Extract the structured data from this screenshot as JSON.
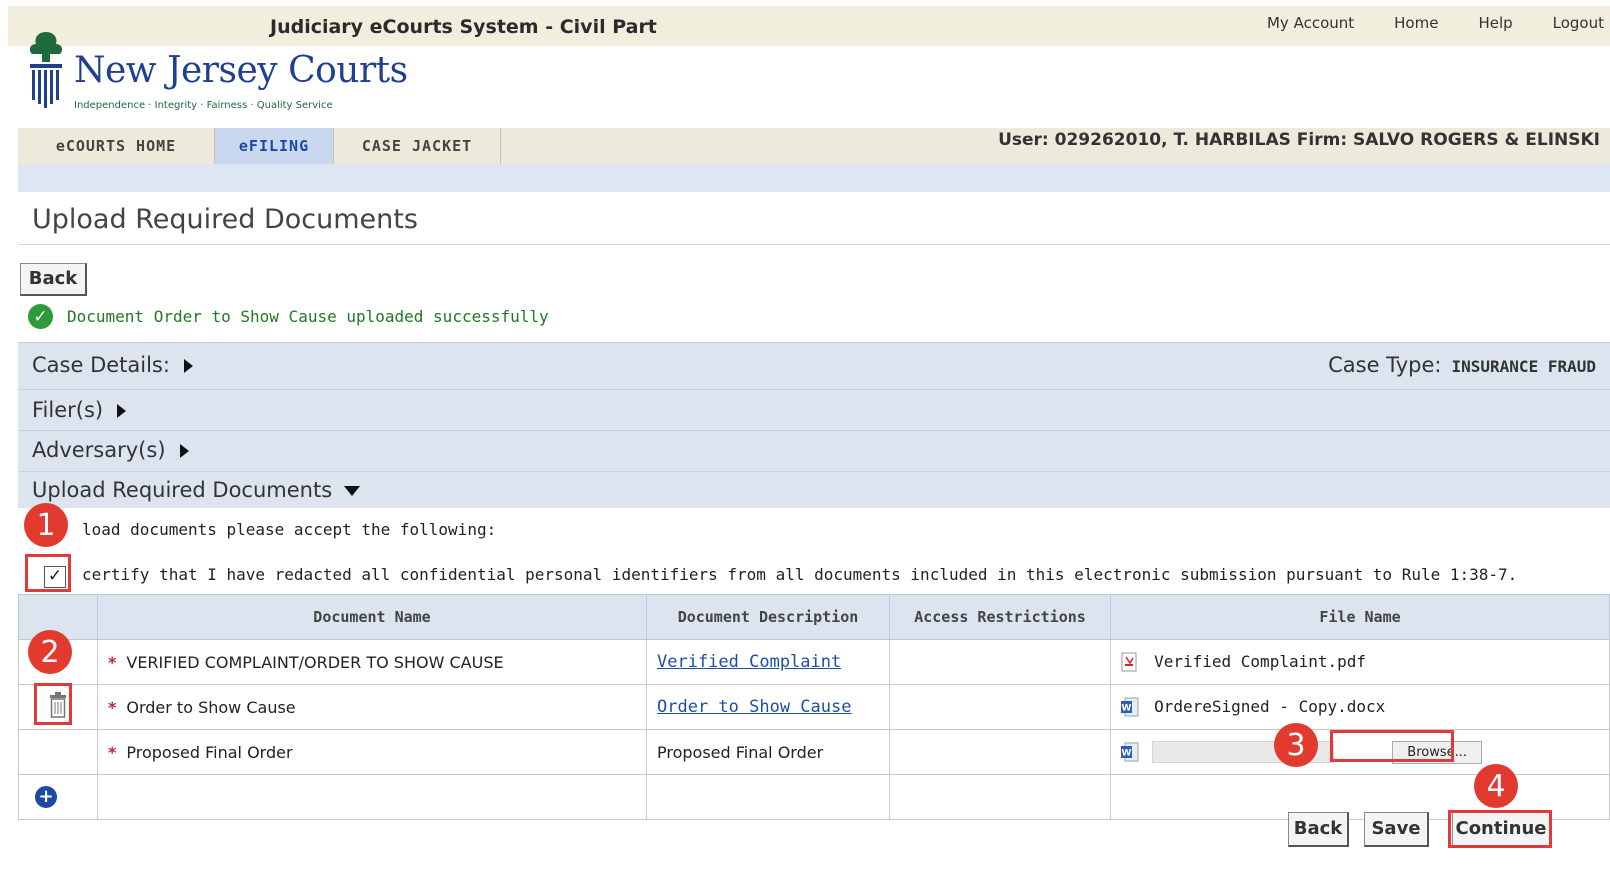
{
  "header": {
    "system_title": "Judiciary eCourts System - Civil Part",
    "links": [
      "My Account",
      "Home",
      "Help",
      "Logout"
    ],
    "logo_title": "New Jersey Courts",
    "logo_tagline": "Independence · Integrity · Fairness · Quality Service",
    "tabs": [
      "eCOURTS HOME",
      "eFILING",
      "CASE JACKET"
    ],
    "active_tab": "eFILING",
    "user_line": "User: 029262010, T. HARBILAS  Firm: SALVO ROGERS & ELINSKI"
  },
  "page": {
    "title": "Upload Required Documents",
    "back_label": "Back",
    "success_message": "Document Order to Show Cause uploaded successfully"
  },
  "sections": {
    "case_details": "Case Details:",
    "case_type_label": "Case Type:",
    "case_type_value": "INSURANCE FRAUD",
    "filers": "Filer(s)",
    "adversaries": "Adversary(s)",
    "upload": "Upload Required Documents"
  },
  "upload": {
    "instruction": "load documents please accept the following:",
    "certify_text": "certify that I have redacted all confidential personal identifiers from all documents included in this electronic submission pursuant to Rule 1:38-7.",
    "certify_checked": true,
    "columns": [
      "Document Name",
      "Document Description",
      "Access Restrictions",
      "File Name"
    ],
    "rows": [
      {
        "name": "VERIFIED COMPLAINT/ORDER TO SHOW CAUSE",
        "description": "Verified Complaint",
        "file": "Verified Complaint.pdf",
        "file_icon": "pdf-icon"
      },
      {
        "name": "Order to Show Cause",
        "description": "Order to Show Cause",
        "file": "OrdereSigned - Copy.docx",
        "file_icon": "word-icon"
      },
      {
        "name": "Proposed Final Order",
        "description": "Proposed Final Order",
        "file": "",
        "browse": "Browse...",
        "file_icon": "word-icon"
      }
    ]
  },
  "footer": {
    "back": "Back",
    "save": "Save",
    "continue": "Continue"
  },
  "annotations": [
    "1",
    "2",
    "3",
    "4"
  ],
  "colors": {
    "accent_blue": "#1c4aa3",
    "section_bg": "#dce4f0",
    "annotation_red": "#e23a2e",
    "success_green": "#2e9a3a"
  }
}
